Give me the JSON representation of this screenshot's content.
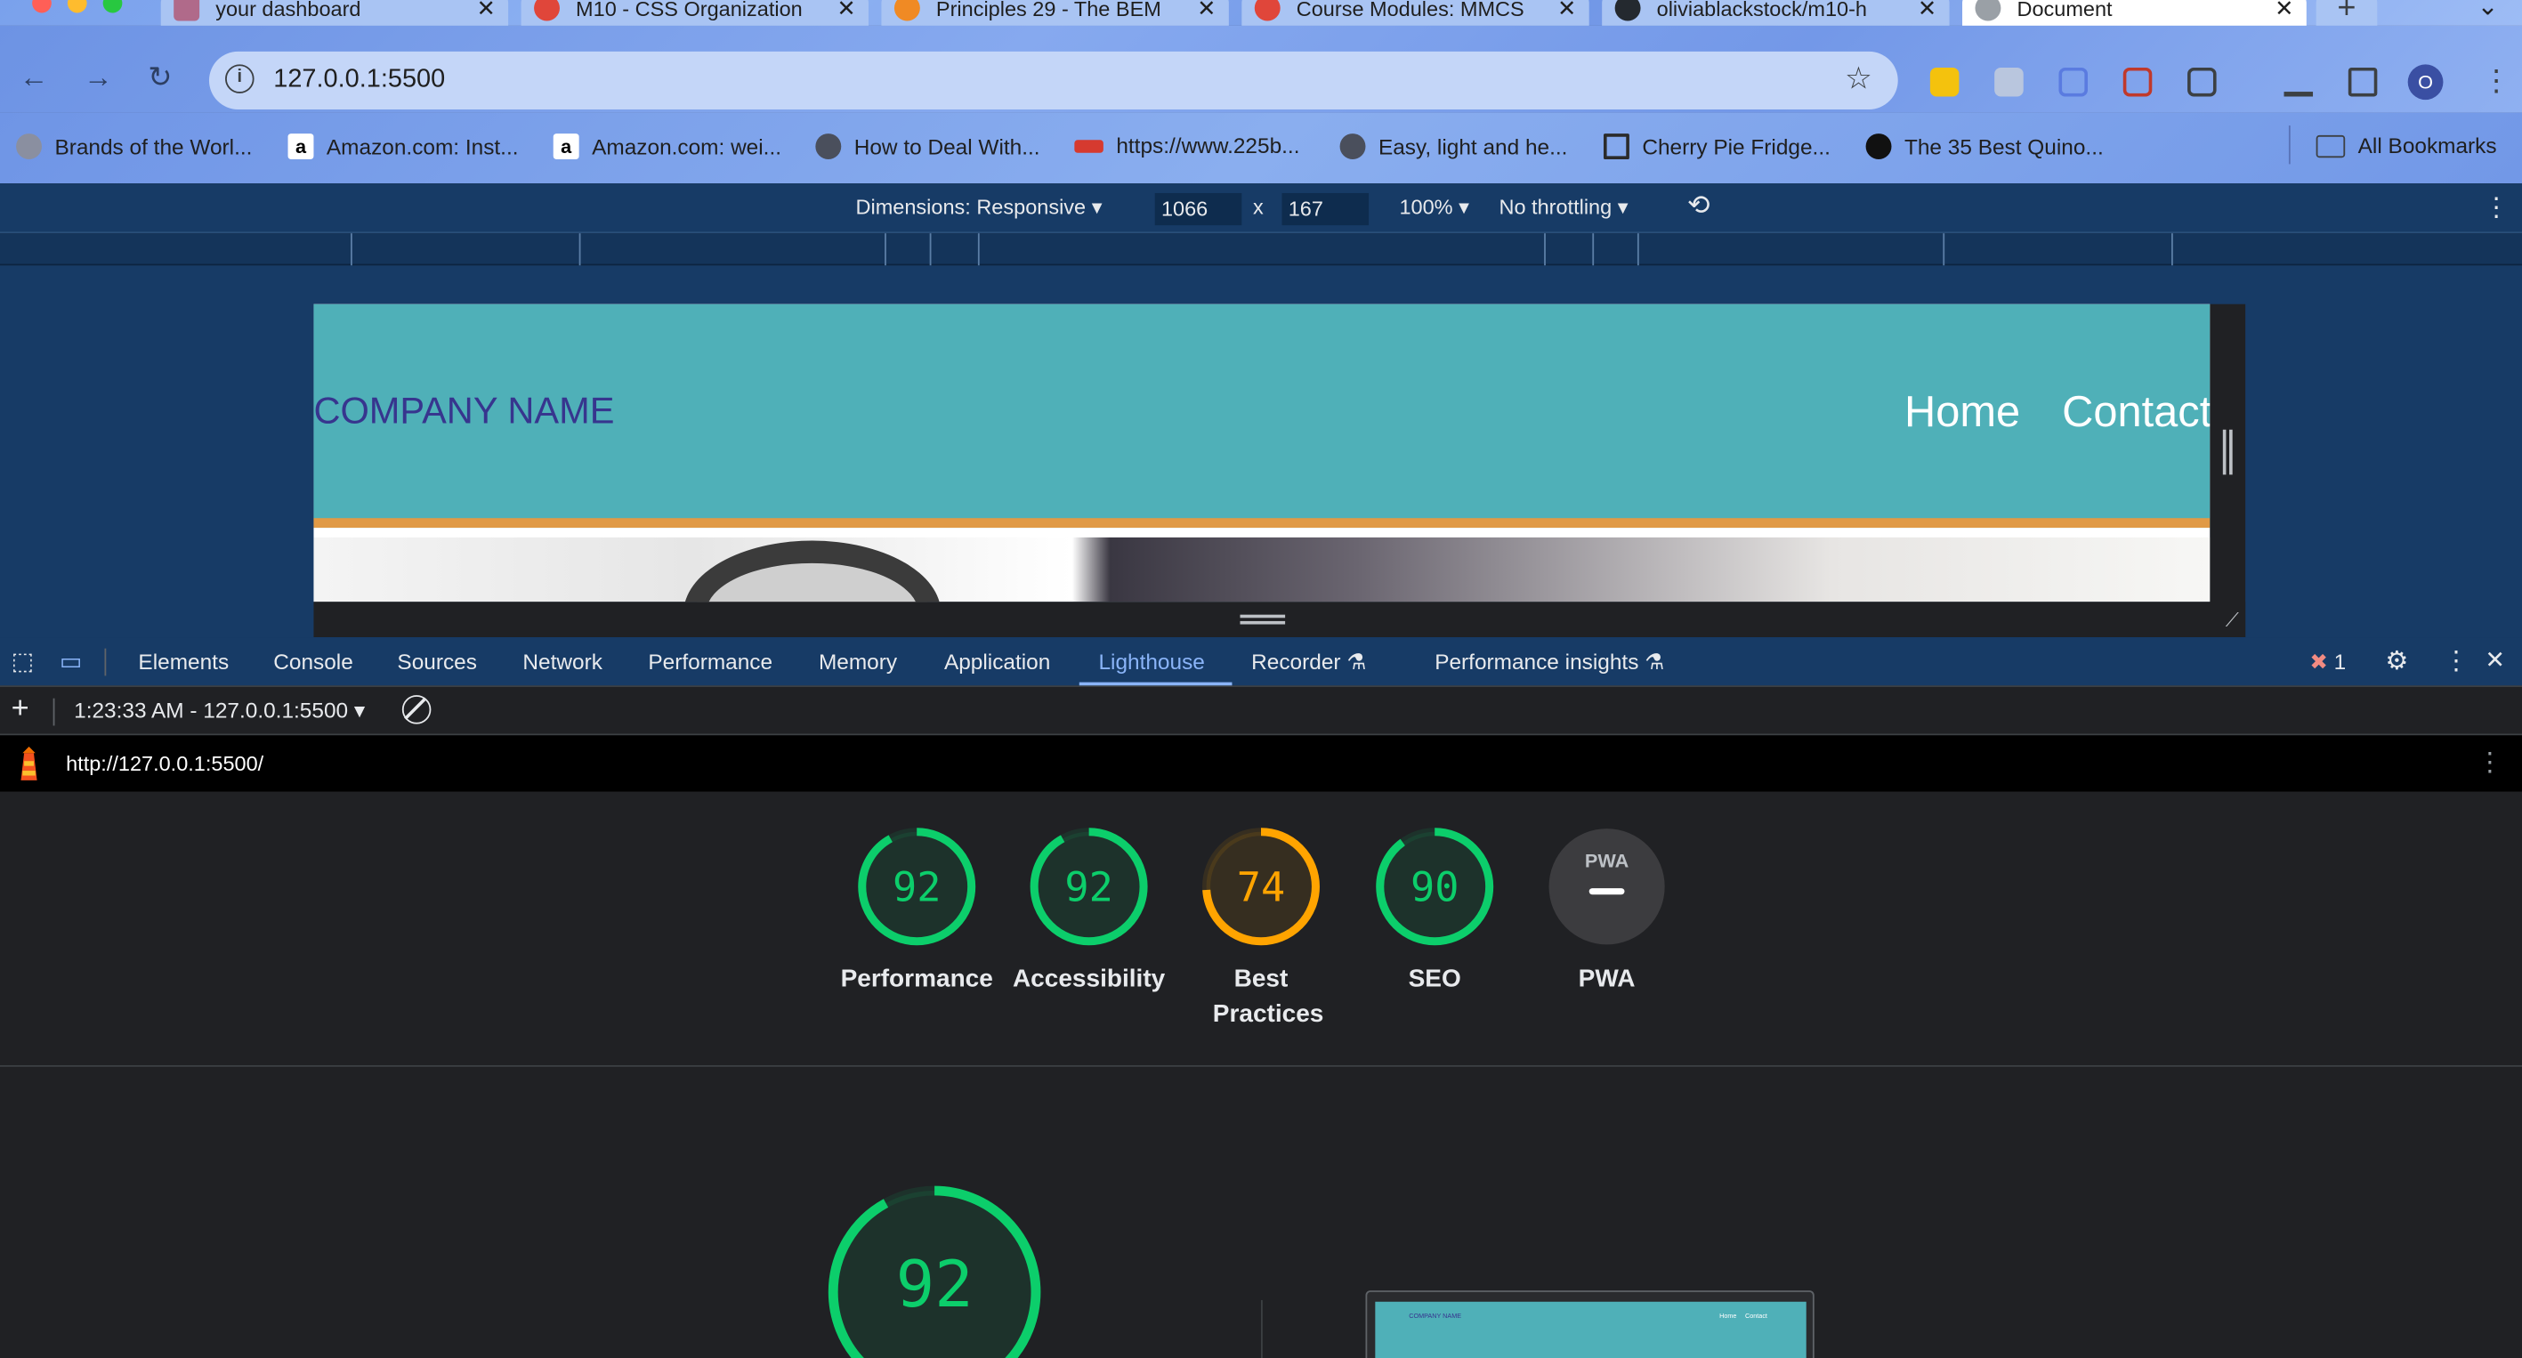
{
  "browser": {
    "tabs": [
      {
        "title": "your dashboard",
        "active": false
      },
      {
        "title": "M10 - CSS Organization",
        "active": false
      },
      {
        "title": "Principles 29 - The BEM",
        "active": false
      },
      {
        "title": "Course Modules: MMCS",
        "active": false
      },
      {
        "title": "oliviablackstock/m10-h",
        "active": false
      },
      {
        "title": "Document",
        "active": true
      }
    ],
    "new_tab": "+",
    "close_tab": "✕",
    "url": "127.0.0.1:5500",
    "profile_initial": "O",
    "bookmarks": [
      "Brands of the Worl...",
      "Amazon.com: Inst...",
      "Amazon.com: wei...",
      "How to Deal With...",
      "https://www.225b...",
      "Easy, light and he...",
      "Cherry Pie Fridge...",
      "The 35 Best Quino..."
    ],
    "all_bookmarks": "All Bookmarks"
  },
  "device_toolbar": {
    "dimensions_label": "Dimensions: Responsive",
    "width": "1066",
    "times": "x",
    "height": "167",
    "zoom": "100%",
    "throttling": "No throttling"
  },
  "site": {
    "company_name": "COMPANY NAME",
    "nav": [
      "Home",
      "Contact"
    ]
  },
  "devtools": {
    "tabs": [
      "Elements",
      "Console",
      "Sources",
      "Network",
      "Performance",
      "Memory",
      "Application",
      "Lighthouse",
      "Recorder",
      "Performance insights"
    ],
    "active_tab": "Lighthouse",
    "error_count": "1",
    "report_selector": "1:23:33 AM - 127.0.0.1:5500",
    "report_url": "http://127.0.0.1:5500/"
  },
  "lighthouse": {
    "scores": [
      {
        "label": "Performance",
        "value": 92,
        "color": "#0cce6b"
      },
      {
        "label": "Accessibility",
        "value": 92,
        "color": "#0cce6b"
      },
      {
        "label": "Best Practices",
        "value": 74,
        "color": "#ffa400"
      },
      {
        "label": "SEO",
        "value": 90,
        "color": "#0cce6b"
      },
      {
        "label": "PWA",
        "value": null,
        "color": "#9e9e9e"
      }
    ],
    "pwa_badge": "PWA",
    "featured_score": 92,
    "thumb_company": "COMPANY NAME",
    "thumb_nav": [
      "Home",
      "Contact"
    ]
  },
  "colors": {
    "pass": "#0cce6b",
    "average": "#ffa400",
    "site_header": "#4fb0b8",
    "site_accent": "#e09a46",
    "company_text": "#37358e"
  }
}
